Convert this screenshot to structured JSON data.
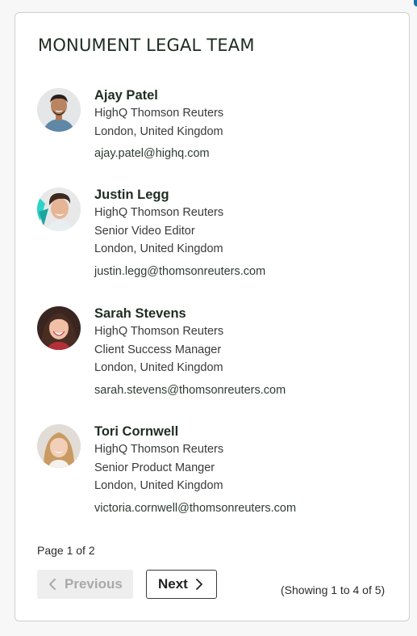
{
  "panel": {
    "title": "MONUMENT LEGAL TEAM"
  },
  "people": [
    {
      "name": "Ajay Patel",
      "lines": [
        "HighQ Thomson Reuters",
        "London, United Kingdom"
      ],
      "email": "ajay.patel@highq.com",
      "avatar": "person-avatar"
    },
    {
      "name": "Justin Legg",
      "lines": [
        "HighQ Thomson Reuters",
        "Senior Video Editor",
        "London, United Kingdom"
      ],
      "email": "justin.legg@thomsonreuters.com",
      "avatar": "person-avatar"
    },
    {
      "name": "Sarah Stevens",
      "lines": [
        "HighQ Thomson Reuters",
        "Client Success Manager",
        "London, United Kingdom"
      ],
      "email": "sarah.stevens@thomsonreuters.com",
      "avatar": "person-avatar"
    },
    {
      "name": "Tori Cornwell",
      "lines": [
        "HighQ Thomson Reuters",
        "Senior Product Manger",
        "London, United Kingdom"
      ],
      "email": "victoria.cornwell@thomsonreuters.com",
      "avatar": "person-avatar"
    }
  ],
  "pagination": {
    "page_label": "Page 1 of 2",
    "previous_label": "Previous",
    "next_label": "Next",
    "showing_label": "(Showing 1 to 4 of 5)"
  },
  "colors": {
    "title": "#1d2b20",
    "disabled_button_bg": "#eeeeee",
    "disabled_button_text": "#a9a9a9",
    "border": "#cfcfcf"
  }
}
